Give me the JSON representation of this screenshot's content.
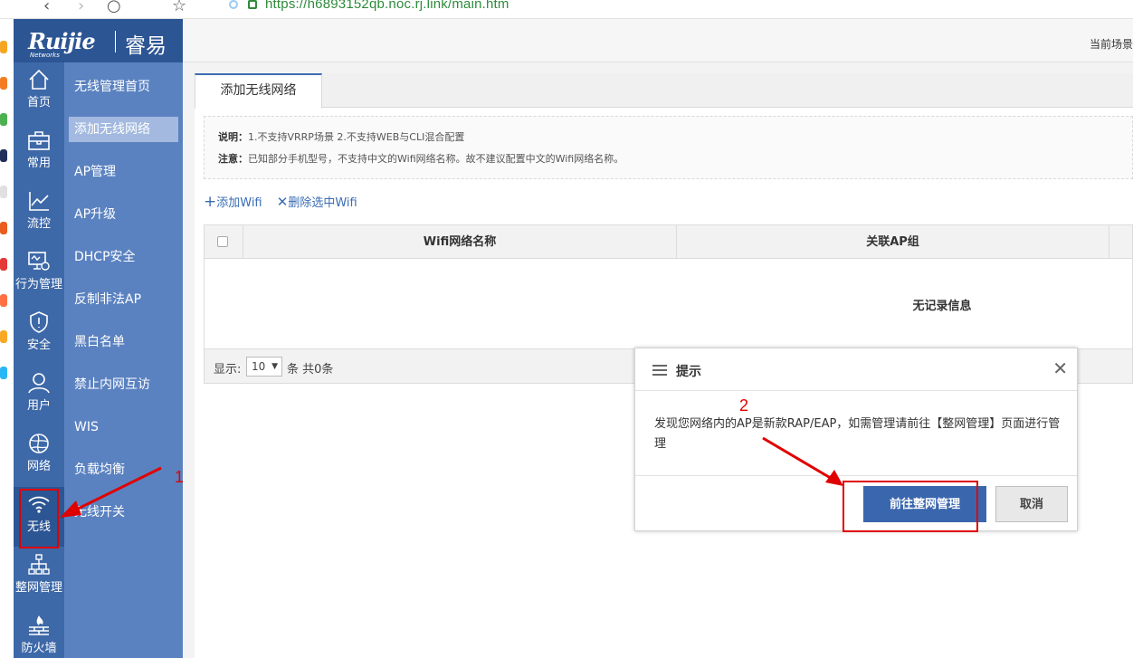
{
  "browser": {
    "url": "https://h6893152qb.noc.rj.link/main.htm"
  },
  "logo": {
    "brand": "Ruijie",
    "brand_sub": "Networks",
    "product": "睿易"
  },
  "header": {
    "scene_label": "当前场景"
  },
  "nav": [
    {
      "label": "首页",
      "icon": "home-icon"
    },
    {
      "label": "常用",
      "icon": "briefcase-icon"
    },
    {
      "label": "流控",
      "icon": "chart-line-icon"
    },
    {
      "label": "行为管理",
      "icon": "monitor-gear-icon"
    },
    {
      "label": "安全",
      "icon": "shield-icon"
    },
    {
      "label": "用户",
      "icon": "user-icon"
    },
    {
      "label": "网络",
      "icon": "globe-icon"
    },
    {
      "label": "无线",
      "icon": "wifi-icon"
    },
    {
      "label": "整网管理",
      "icon": "network-tree-icon"
    },
    {
      "label": "防火墙",
      "icon": "firewall-icon"
    }
  ],
  "subnav": [
    {
      "label": "无线管理首页"
    },
    {
      "label": "添加无线网络"
    },
    {
      "label": "AP管理"
    },
    {
      "label": "AP升级"
    },
    {
      "label": "DHCP安全"
    },
    {
      "label": "反制非法AP"
    },
    {
      "label": "黑白名单"
    },
    {
      "label": "禁止内网互访"
    },
    {
      "label": "WIS"
    },
    {
      "label": "负载均衡"
    },
    {
      "label": "无线开关"
    }
  ],
  "tab": {
    "label": "添加无线网络"
  },
  "notice": {
    "line1_label": "说明：",
    "line1_text": "1.不支持VRRP场景 2.不支持WEB与CLI混合配置",
    "line2_label": "注意：",
    "line2_text": "已知部分手机型号，不支持中文的Wifi网络名称。故不建议配置中文的Wifi网络名称。"
  },
  "toolbar": {
    "add_label": "添加Wifi",
    "delete_label": "删除选中Wifi"
  },
  "table": {
    "columns": [
      "Wifi网络名称",
      "关联AP组"
    ],
    "empty_text": "无记录信息"
  },
  "pager": {
    "show_label": "显示:",
    "page_size": "10",
    "total_text": "条 共0条"
  },
  "dialog": {
    "title": "提示",
    "message": "发现您网络内的AP是新款RAP/EAP，如需管理请前往【整网管理】页面进行管理",
    "primary_label": "前往整网管理",
    "cancel_label": "取消"
  },
  "annotations": {
    "step1": "1",
    "step2": "2",
    "color": "#e00000"
  }
}
